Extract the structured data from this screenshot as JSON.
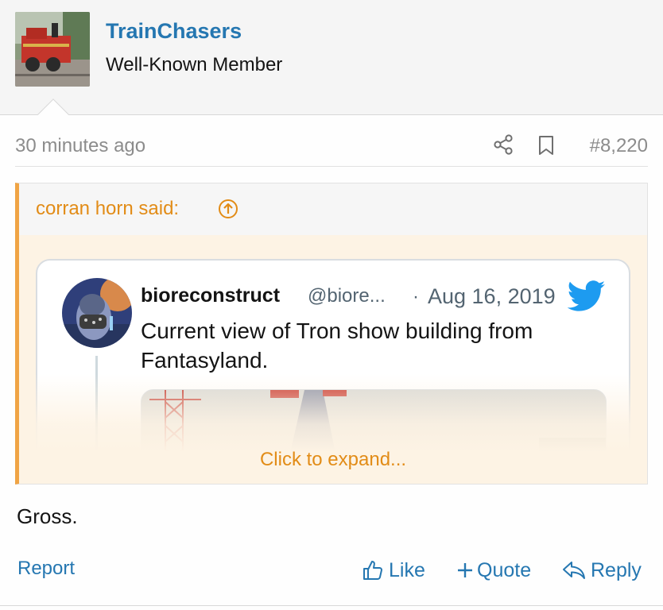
{
  "user": {
    "name": "TrainChasers",
    "title": "Well-Known Member",
    "avatar_icon": "train-photo-avatar"
  },
  "meta": {
    "time": "30 minutes ago",
    "post_number": "#8,220",
    "share_icon": "share-icon",
    "bookmark_icon": "bookmark-icon"
  },
  "quote": {
    "author": "corran horn said:",
    "up_icon": "arrow-up-circle-icon",
    "expand_label": "Click to expand...",
    "tweet": {
      "name": "bioreconstruct",
      "handle": "@biore...",
      "separator": "·",
      "date": "Aug 16, 2019",
      "text": "Current view of Tron show building from Fantasyland.",
      "brand_icon": "twitter-bird-icon"
    }
  },
  "post": {
    "body": "Gross."
  },
  "actions": {
    "report": "Report",
    "like": "Like",
    "quote": "Quote",
    "reply": "Reply"
  },
  "colors": {
    "link": "#2577b1",
    "quote_accent": "#f0a445",
    "quote_text": "#e28c17",
    "twitter_blue": "#1d9bf0"
  }
}
